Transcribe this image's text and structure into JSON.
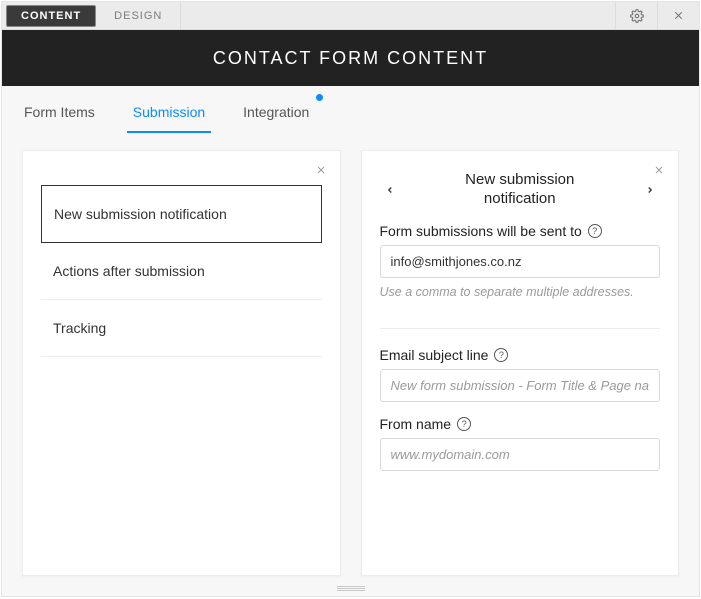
{
  "topTabs": {
    "content": "CONTENT",
    "design": "DESIGN"
  },
  "header": {
    "title": "CONTACT FORM CONTENT"
  },
  "subTabs": {
    "formItems": "Form Items",
    "submission": "Submission",
    "integration": "Integration"
  },
  "leftPanel": {
    "items": {
      "notification": "New submission notification",
      "actions": "Actions after submission",
      "tracking": "Tracking"
    }
  },
  "rightPanel": {
    "titleLine1": "New submission",
    "titleLine2": "notification",
    "sendTo": {
      "label": "Form submissions will be sent to",
      "value": "info@smithjones.co.nz",
      "helper": "Use a comma to separate multiple addresses."
    },
    "subject": {
      "label": "Email subject line",
      "placeholder": "New form submission - Form Title & Page nam"
    },
    "fromName": {
      "label": "From name",
      "placeholder": "www.mydomain.com"
    },
    "helpGlyph": "?"
  }
}
